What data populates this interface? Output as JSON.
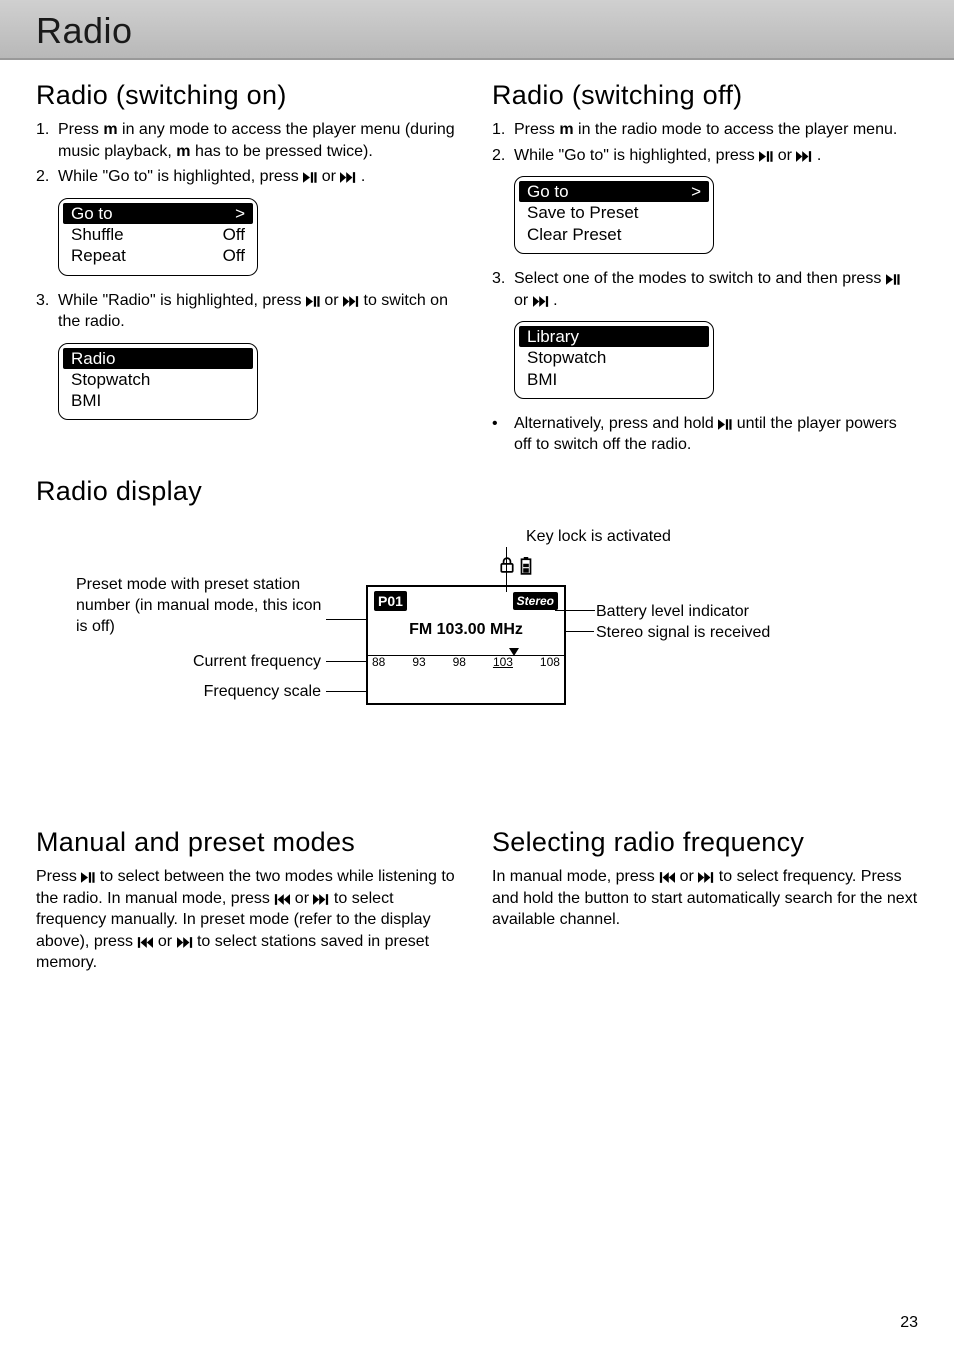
{
  "header": {
    "title": "Radio"
  },
  "left": {
    "h2a": "Radio (switching on)",
    "steps_a": [
      {
        "num": "1.",
        "pre": "Press ",
        "bold1": "m",
        "mid": " in any mode to access the player menu (during music playback, ",
        "bold2": "m",
        "post": " has to be pressed twice)."
      },
      {
        "num": "2.",
        "pre": "While \"Go to\" is highlighted, press ",
        "icons": "playpause-or-next",
        "post": " ."
      },
      {
        "num": "3.",
        "pre": "While \"Radio\" is highlighted, press ",
        "icons": "playpause-or-next",
        "post": "  to switch on the radio."
      }
    ],
    "screen1": {
      "hl": "Go to",
      "hlr": ">",
      "r1a": "Shuffle",
      "r1b": "Off",
      "r2a": "Repeat",
      "r2b": "Off"
    },
    "screen2": {
      "hl": "Radio",
      "r1": "Stopwatch",
      "r2": "BMI"
    }
  },
  "right": {
    "h2b": "Radio (switching off)",
    "steps_b": [
      {
        "num": "1.",
        "pre": "Press ",
        "bold1": "m",
        "post": " in the radio mode to access the player menu."
      },
      {
        "num": "2.",
        "pre": "While \"Go to\" is highlighted, press ",
        "icons": "playpause-or-next",
        "post": " ."
      },
      {
        "num": "3.",
        "pre": "Select one of the modes to switch to and then press ",
        "icons": "playpause-or-next",
        "post": " ."
      }
    ],
    "screen3": {
      "hl": "Go to",
      "hlr": ">",
      "r1": "Save to Preset",
      "r2": "Clear Preset"
    },
    "screen4": {
      "hl": "Library",
      "r1": "Stopwatch",
      "r2": "BMI"
    },
    "alt": {
      "pre": "Alternatively, press and hold ",
      "post": " until the player powers off to switch off the radio."
    }
  },
  "display": {
    "h2": "Radio display",
    "callouts": {
      "keylock": "Key lock is activated",
      "preset": "Preset mode with preset station number (in manual mode, this icon is off)",
      "freq": "Current frequency",
      "scale": "Frequency scale",
      "battery": "Battery level indicator",
      "stereo": "Stereo signal is received"
    },
    "lcd": {
      "preset": "P01",
      "stereo": "Stereo",
      "freq": "FM 103.00 MHz",
      "ticks": [
        "88",
        "93",
        "98",
        "103",
        "108"
      ]
    }
  },
  "bottom": {
    "h2l": "Manual and preset modes",
    "pl": {
      "a": "Press ",
      "b": " to select between the two modes while listening to the radio. In manual mode, press ",
      "c": " or ",
      "d": " to select frequency manually. In preset mode (refer to the display above), press ",
      "e": " or ",
      "f": " to select stations saved in preset memory."
    },
    "h2r": "Selecting radio frequency",
    "pr": {
      "a": "In manual mode, press ",
      "b": " or ",
      "c": " to select frequency. Press and hold the button to start automatically search for the next available channel."
    }
  },
  "page": "23"
}
